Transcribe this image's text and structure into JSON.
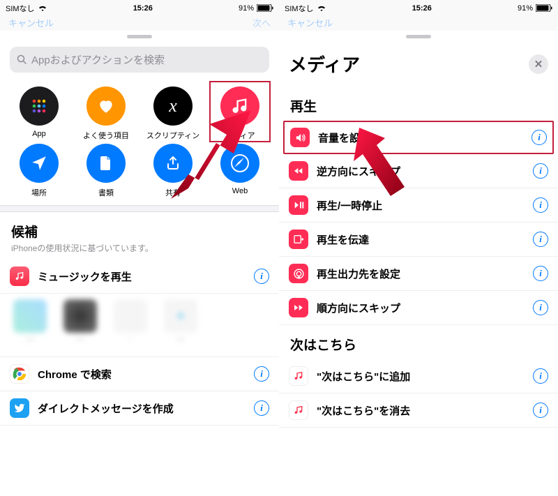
{
  "status": {
    "sim": "SIMなし",
    "time": "15:26",
    "battery": "91%"
  },
  "nav": {
    "cancel": "キャンセル",
    "next": "次へ"
  },
  "left": {
    "search_placeholder": "Appおよびアクションを検索",
    "categories": [
      {
        "label": "App",
        "color": "#1c1c1e",
        "icon": "grid"
      },
      {
        "label": "よく使う項目",
        "color": "#ff9500",
        "icon": "heart"
      },
      {
        "label": "スクリプティン",
        "color": "#000000",
        "icon": "x"
      },
      {
        "label": "メディア",
        "color": "#ff2d55",
        "icon": "music"
      },
      {
        "label": "場所",
        "color": "#007aff",
        "icon": "location"
      },
      {
        "label": "書類",
        "color": "#007aff",
        "icon": "doc"
      },
      {
        "label": "共有",
        "color": "#007aff",
        "icon": "share"
      },
      {
        "label": "Web",
        "color": "#007aff",
        "icon": "safari"
      }
    ],
    "suggestions_title": "候補",
    "suggestions_sub": "iPhoneの使用状況に基づいています。",
    "sug1": "ミュージックを再生",
    "sug2": "Chrome で検索",
    "sug3": "ダイレクトメッセージを作成"
  },
  "right": {
    "title": "メディア",
    "sec_playback": "再生",
    "items": [
      "音量を設定",
      "逆方向にスキップ",
      "再生/一時停止",
      "再生を伝達",
      "再生出力先を設定",
      "順方向にスキップ"
    ],
    "sec_upnext": "次はこちら",
    "upnext_items": [
      "\"次はこちら\"に追加",
      "\"次はこちら\"を消去"
    ]
  }
}
